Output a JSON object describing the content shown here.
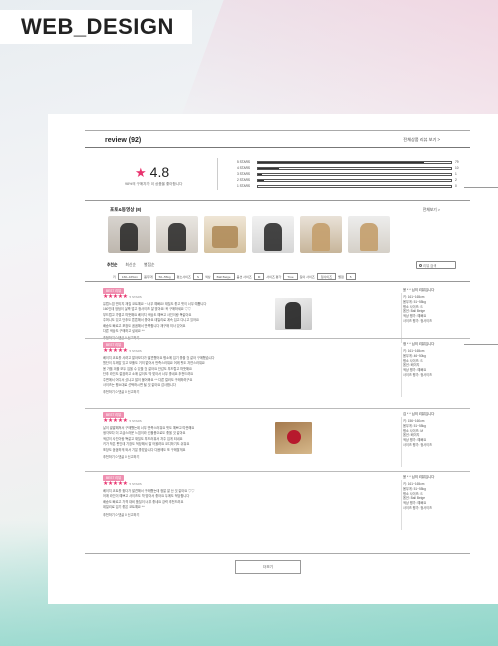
{
  "brand": "WEB_DESIGN",
  "header": {
    "title": "review (92)",
    "link": "전체상품 리뷰 보기 >"
  },
  "summary": {
    "score": "4.8",
    "caption": "98%의 구매자가 이 상품을 좋아합니다"
  },
  "distribution": [
    {
      "label": "5 STARS",
      "count": "79",
      "fraction": 0.86
    },
    {
      "label": "4 STARS",
      "count": "10",
      "fraction": 0.11
    },
    {
      "label": "3 STARS",
      "count": "1",
      "fraction": 0.02
    },
    {
      "label": "2 STARS",
      "count": "2",
      "fraction": 0.03
    },
    {
      "label": "1 STARS",
      "count": "0",
      "fraction": 0.0
    }
  ],
  "photos": {
    "title": "포토&동영상 (8)",
    "link": "전체보기 >"
  },
  "tabs": [
    "추천순",
    "최신순",
    "별점순"
  ],
  "search_placeholder": "리뷰 검색",
  "filters": [
    "키",
    "160~165cm",
    "몸무게",
    "50~55kg",
    "평소사이즈",
    "S",
    "색상",
    "Ball Beige",
    "옵션 사이즈",
    "M",
    "사이즈 평가",
    "True",
    "길이 사이즈",
    "정사이즈",
    "별점",
    "5"
  ],
  "reviews": [
    {
      "badge": "BEST 리뷰",
      "user": "5 STARS",
      "lines": [
        "유럽느낌 빈티지 재질 코트예요 ~ 너무 예뻐요! 재질도 좋고 핏이 너무 예쁩니다",
        "160인데 엉덩이 살짝 덮고 정사이즈 잘 맞아요! 꼭 구매하세요 ♡♡",
        "부드럽고 가볍고 따뜻해요 베이지 색상도 예쁘고 사진이랑 똑같아요",
        "주머니도 있고 단추도 튼튼해서 좋아요 데일리로 계속 입고 다니고 있어요",
        "배송도 빠르고 포장도 꼼꼼해서 만족합니다 재구매 의사 있어요",
        "다른 색상도 구매하고 싶네요 ^^"
      ],
      "actions": "추천하기 0  댓글 0  신고하기",
      "profile": {
        "name": "윤 * * 님의 리뷰입니다",
        "lines": [
          "키: 161~165cm",
          "몸무게: 51~55kg",
          "평소 사이즈: S",
          "옵션: Ball Beige",
          "색상 평가: 예뻐요",
          "사이즈 평가: 정사이즈"
        ]
      }
    },
    {
      "badge": "BEST 리뷰",
      "user": "5 STARS",
      "lines": [
        "베이지 코트를 사려고 알아보다가 발견했어요 평소에 입기 좋을 것 같아 구매했습니다",
        "원단이 두께감 있고 보풀도 거의 없어서 만족스러워요 어깨 핏도 자연스러워요",
        "봄 가을 겨울 모두 입을 수 있을 것 같아요 안감도 부드럽고 따뜻해요",
        "단추 라인도 깔끔하고 소매 길이도 딱 맞아서 너무 좋네요 추천드려요",
        "주변에서 어디서 샀냐고 많이 물어봐요 ^^ 다른 컬러도 구매하려구요",
        "사이즈는 평소대로 선택하시면 될 것 같아요 감사합니다"
      ],
      "actions": "추천하기 0  댓글 0  신고하기",
      "profile": {
        "name": "정 * * 님의 리뷰입니다",
        "lines": [
          "키: 161~165cm",
          "몸무게: 46~50kg",
          "평소 사이즈: S",
          "옵션: 베이지",
          "색상 평가: 예뻐요",
          "사이즈 평가: 정사이즈"
        ]
      }
    },
    {
      "badge": "BEST 리뷰",
      "user": "5 STARS",
      "lines": [
        "날이 쌀쌀해져서 구매했는데 너무 만족스러워요 핏도 예쁘고 따뜻해요",
        "생각보다 더 고급스러운 느낌이라 선물용으로도 좋을 것 같아요",
        "색감이 사진이랑 똑같고 재질도 부드러워서 자주 입게 되네요",
        "키가 작은 편인데 기장도 적당해서 잘 어울려요 코디하기도 쉬워요",
        "포장도 꼼꼼하게 와서 기분 좋았습니다 다음에도 또 구매할게요"
      ],
      "actions": "추천하기 0  댓글 0  신고하기",
      "profile": {
        "name": "김 * * 님의 리뷰입니다",
        "lines": [
          "키: 156~160cm",
          "몸무게: 51~55kg",
          "평소 사이즈: M",
          "옵션: 베이지",
          "색상 평가: 예뻐요",
          "사이즈 평가: 정사이즈"
        ]
      }
    },
    {
      "badge": "BEST 리뷰",
      "user": "5 STARS",
      "lines": [
        "베이지 코트를 찾다가 발견해서 구매했는데 정말 잘 산 것 같아요 ♡♡",
        "어깨 라인이 예쁘고 사이즈도 딱 맞아서 좋아요 두께도 적당합니다",
        "배송도 빠르고 가격 대비 품질이 너무 좋네요 강력 추천드려요",
        "데일리로 입기 좋은 코트예요 ^^"
      ],
      "actions": "추천하기 0  댓글 0  신고하기",
      "profile": {
        "name": "윤 * * 님의 리뷰입니다",
        "lines": [
          "키: 161~165cm",
          "몸무게: 51~55kg",
          "평소 사이즈: S",
          "옵션: Ball Beige",
          "색상 평가: 예뻐요",
          "사이즈 평가: 정사이즈"
        ]
      }
    }
  ],
  "more_button": "더보기"
}
